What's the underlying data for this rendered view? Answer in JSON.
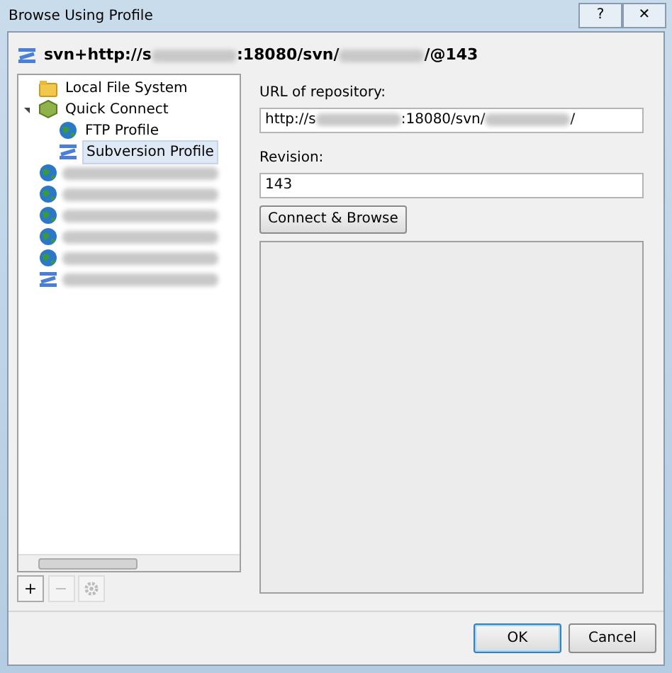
{
  "window": {
    "title": "Browse Using Profile",
    "buttons": [
      {
        "kind": "help",
        "label": "?"
      },
      {
        "kind": "close",
        "label": "✕"
      }
    ]
  },
  "header": {
    "segments": [
      {
        "kind": "text",
        "text": "svn+http://s"
      },
      {
        "kind": "blur"
      },
      {
        "kind": "text",
        "text": ":18080/svn/"
      },
      {
        "kind": "blur"
      },
      {
        "kind": "text",
        "text": "/@143"
      }
    ]
  },
  "tree": [
    {
      "kind": "folder",
      "label": "Local File System",
      "selected": false
    },
    {
      "kind": "cube",
      "label": "Quick Connect",
      "selected": false,
      "expanded": true,
      "children": [
        {
          "kind": "globe",
          "label": "FTP Profile",
          "selected": false
        },
        {
          "kind": "svn",
          "label": "Subversion Profile",
          "selected": true
        }
      ]
    },
    {
      "kind": "globe",
      "selected": false
    },
    {
      "kind": "globe",
      "selected": false
    },
    {
      "kind": "globe",
      "selected": false
    },
    {
      "kind": "globe",
      "selected": false
    },
    {
      "kind": "globe",
      "selected": false
    },
    {
      "kind": "svn",
      "selected": false
    }
  ],
  "tree_buttons": [
    {
      "kind": "add",
      "label": "+",
      "disabled": false
    },
    {
      "kind": "remove",
      "label": "−",
      "disabled": true
    },
    {
      "kind": "settings",
      "disabled": true
    }
  ],
  "url": {
    "label": "URL of repository:",
    "segments": [
      {
        "kind": "text",
        "text": "http://s"
      },
      {
        "kind": "blur"
      },
      {
        "kind": "text",
        "text": ":18080/svn/"
      },
      {
        "kind": "blur"
      },
      {
        "kind": "text",
        "text": "/"
      }
    ]
  },
  "revision": {
    "label": "Revision:",
    "value": "143"
  },
  "connect_button": "Connect & Browse",
  "buttons": [
    {
      "label": "OK",
      "default": true
    },
    {
      "label": "Cancel",
      "default": false
    }
  ]
}
